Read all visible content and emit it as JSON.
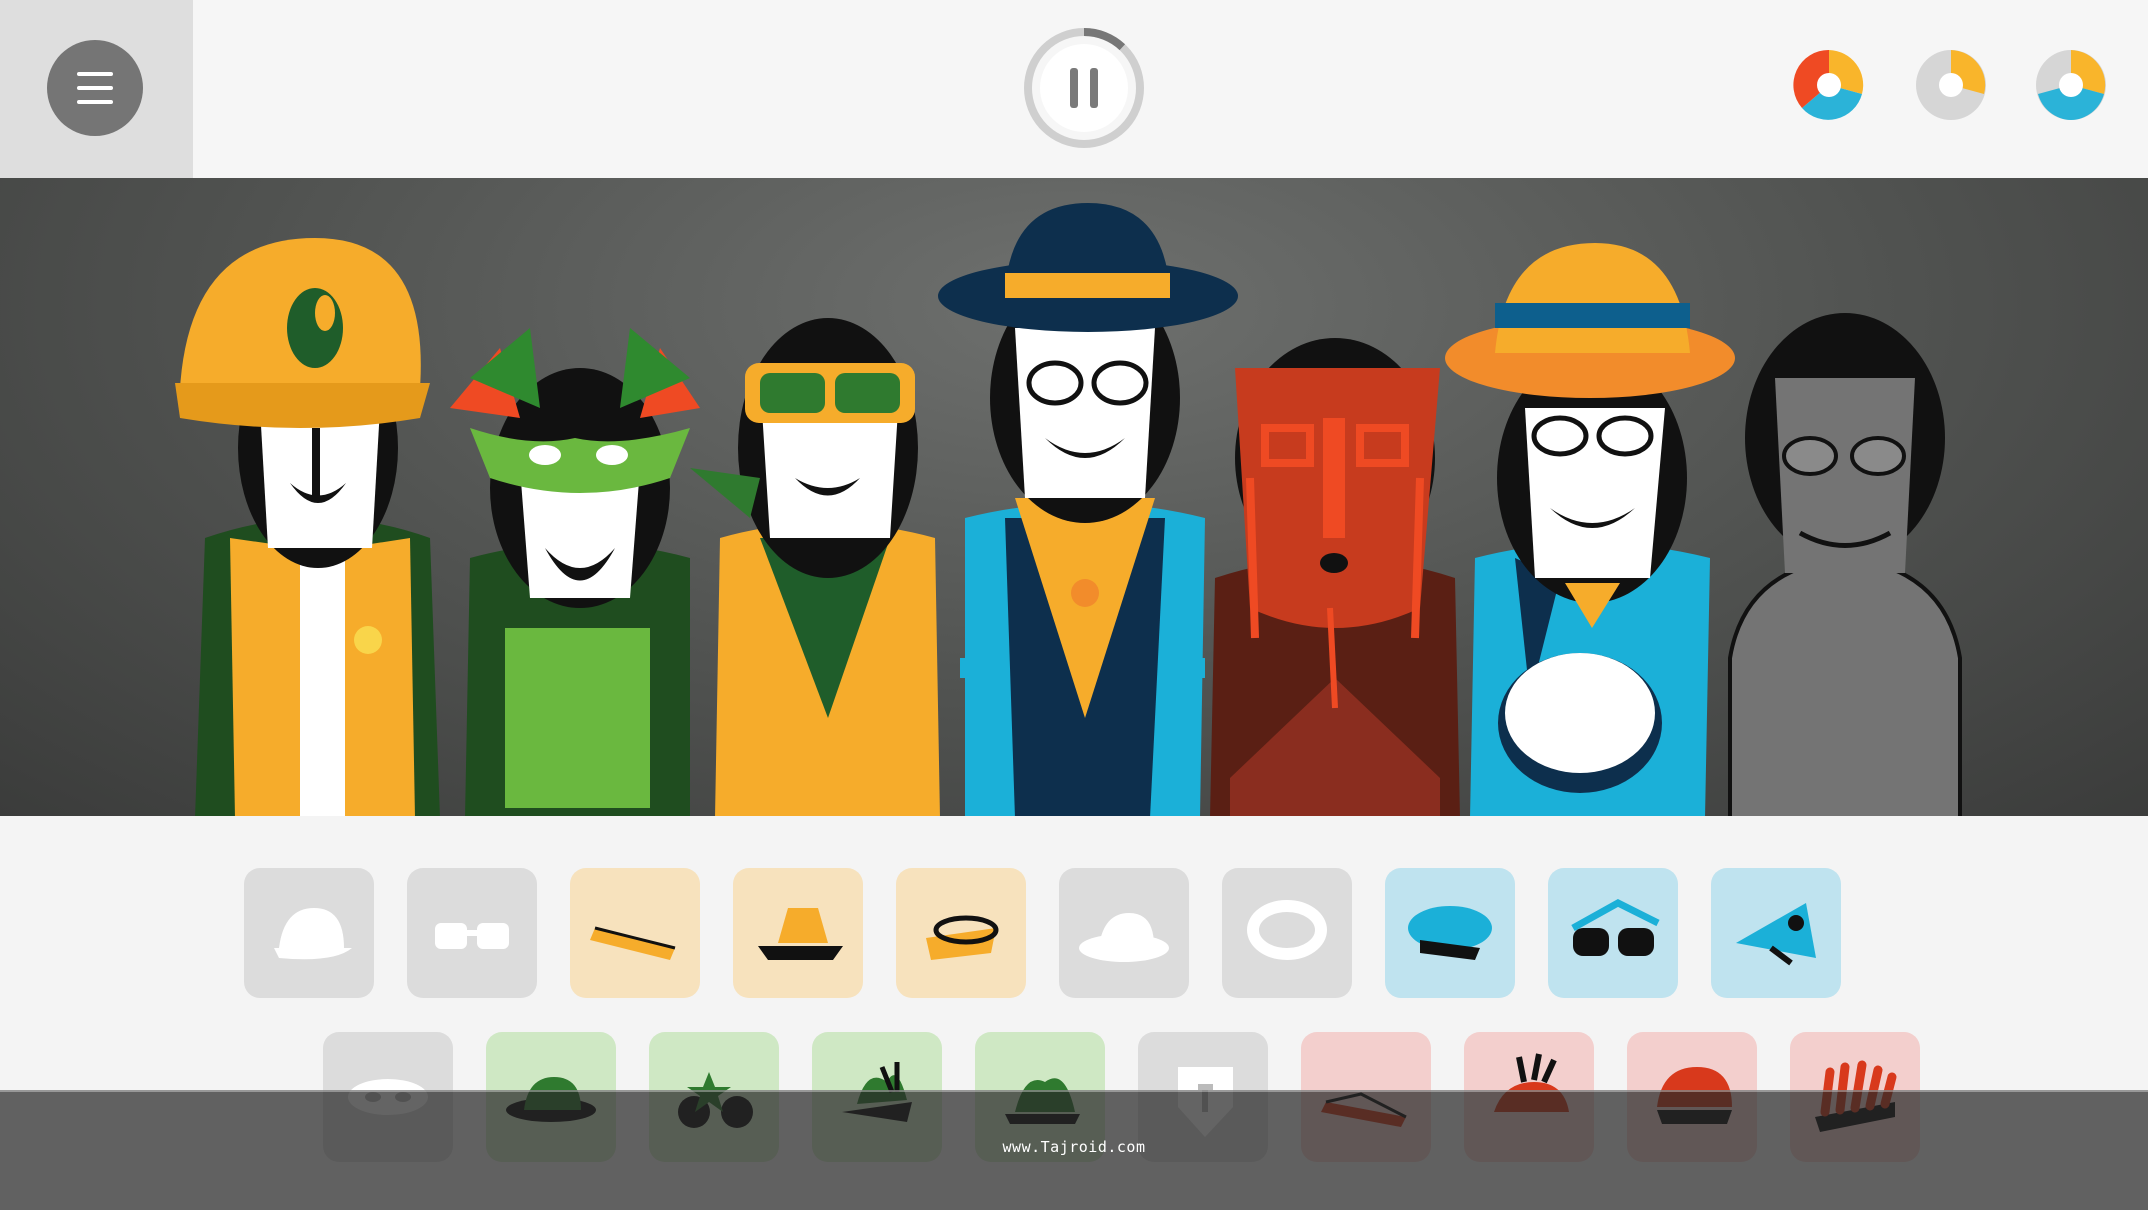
{
  "app": {
    "menu_icon": "hamburger-menu-icon",
    "pause_icon": "pause-icon",
    "progress": 0.12
  },
  "bonuses": [
    {
      "name": "bonus-1",
      "colors": [
        "#ef4a23",
        "#f9b52b",
        "#2bb3d8",
        "#d6d6d6"
      ]
    },
    {
      "name": "bonus-2",
      "colors": [
        "#f9b52b",
        "#d6d6d6"
      ]
    },
    {
      "name": "bonus-3",
      "colors": [
        "#f9b52b",
        "#2bb3d8",
        "#d6d6d6"
      ]
    }
  ],
  "performers": [
    {
      "slot": 1,
      "costume": "yellow-cap-vest",
      "active": true
    },
    {
      "slot": 2,
      "costume": "green-feather-mask",
      "active": true
    },
    {
      "slot": 3,
      "costume": "yellow-sunglasses-scarf",
      "active": true
    },
    {
      "slot": 4,
      "costume": "navy-hat-blue-vest",
      "active": true
    },
    {
      "slot": 5,
      "costume": "red-tribal-mask",
      "active": true
    },
    {
      "slot": 6,
      "costume": "orange-hat-drum",
      "active": true
    },
    {
      "slot": 7,
      "costume": "empty-gray",
      "active": false
    }
  ],
  "sound_icons_row1": [
    {
      "icon": "cap-icon",
      "color": "gray"
    },
    {
      "icon": "glasses-icon",
      "color": "gray"
    },
    {
      "icon": "headband-icon",
      "color": "yellow"
    },
    {
      "icon": "bucket-hat-icon",
      "color": "yellow"
    },
    {
      "icon": "visor-icon",
      "color": "yellow"
    },
    {
      "icon": "fedora-icon",
      "color": "gray"
    },
    {
      "icon": "ring-icon",
      "color": "gray"
    },
    {
      "icon": "beret-icon",
      "color": "blue"
    },
    {
      "icon": "sunglasses-icon",
      "color": "blue"
    },
    {
      "icon": "bird-hat-icon",
      "color": "blue"
    }
  ],
  "sound_icons_row2": [
    {
      "icon": "mask-icon",
      "color": "gray"
    },
    {
      "icon": "green-hat-icon",
      "color": "green"
    },
    {
      "icon": "star-glasses-icon",
      "color": "green"
    },
    {
      "icon": "leaf-cap-icon",
      "color": "green"
    },
    {
      "icon": "leaf-hat-icon",
      "color": "green"
    },
    {
      "icon": "shield-icon",
      "color": "gray"
    },
    {
      "icon": "red-band-icon",
      "color": "red"
    },
    {
      "icon": "red-feather-hat-icon",
      "color": "red"
    },
    {
      "icon": "red-helmet-icon",
      "color": "red"
    },
    {
      "icon": "red-headdress-icon",
      "color": "red"
    }
  ],
  "watermark": "www.Tajroid.com"
}
